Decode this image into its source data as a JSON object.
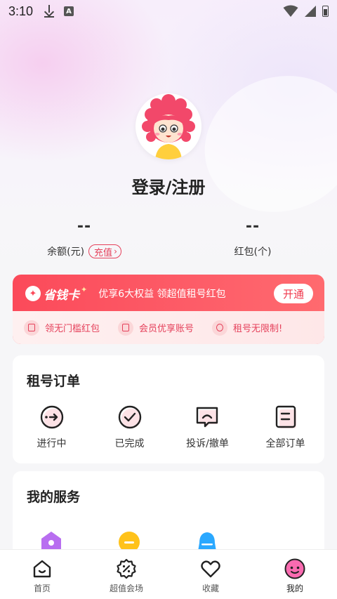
{
  "status_bar": {
    "time": "3:10",
    "icons": [
      "download-icon",
      "a-icon",
      "wifi-icon",
      "signal-icon",
      "battery-icon"
    ]
  },
  "profile": {
    "login_label": "登录/注册"
  },
  "stats": {
    "balance_value": "--",
    "balance_label": "余额(元)",
    "recharge_label": "充值",
    "redpacket_value": "--",
    "redpacket_label": "红包(个)"
  },
  "vip_card": {
    "logo_text": "省钱卡",
    "description": "优享6大权益 领超值租号红包",
    "open_button": "开通",
    "perks": [
      "领无门槛红包",
      "会员优享账号",
      "租号无限制!"
    ]
  },
  "orders": {
    "title": "租号订单",
    "items": [
      {
        "label": "进行中",
        "icon": "in-progress-icon"
      },
      {
        "label": "已完成",
        "icon": "check-icon"
      },
      {
        "label": "投诉/撤单",
        "icon": "complaint-icon"
      },
      {
        "label": "全部订单",
        "icon": "all-orders-icon"
      }
    ]
  },
  "services": {
    "title": "我的服务"
  },
  "tab_bar": {
    "tabs": [
      {
        "label": "首页",
        "icon": "home-icon"
      },
      {
        "label": "超值会场",
        "icon": "discount-icon"
      },
      {
        "label": "收藏",
        "icon": "heart-icon"
      },
      {
        "label": "我的",
        "icon": "profile-face-icon"
      }
    ],
    "active": "我的"
  },
  "colors": {
    "accent": "#e5415b",
    "vip_red": "#fb4a5a",
    "service_purple": "#b86ef0",
    "service_yellow": "#ffc21a",
    "service_blue": "#2aa8ff"
  }
}
